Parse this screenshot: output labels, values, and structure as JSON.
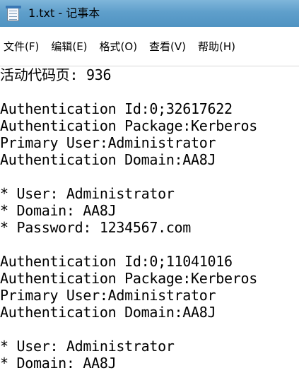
{
  "window": {
    "title": "1.txt - 记事本"
  },
  "menu": {
    "items": [
      {
        "label": "文件(F)"
      },
      {
        "label": "编辑(E)"
      },
      {
        "label": "格式(O)"
      },
      {
        "label": "查看(V)"
      },
      {
        "label": "帮助(H)"
      }
    ]
  },
  "editor": {
    "lines": [
      "活动代码页: 936",
      "",
      "Authentication Id:0;32617622",
      "Authentication Package:Kerberos",
      "Primary User:Administrator",
      "Authentication Domain:AA8J",
      "",
      "* User: Administrator",
      "* Domain: AA8J",
      "* Password: 1234567.com",
      "",
      "Authentication Id:0;11041016",
      "Authentication Package:Kerberos",
      "Primary User:Administrator",
      "Authentication Domain:AA8J",
      "",
      "* User: Administrator",
      "* Domain: AA8J"
    ]
  }
}
